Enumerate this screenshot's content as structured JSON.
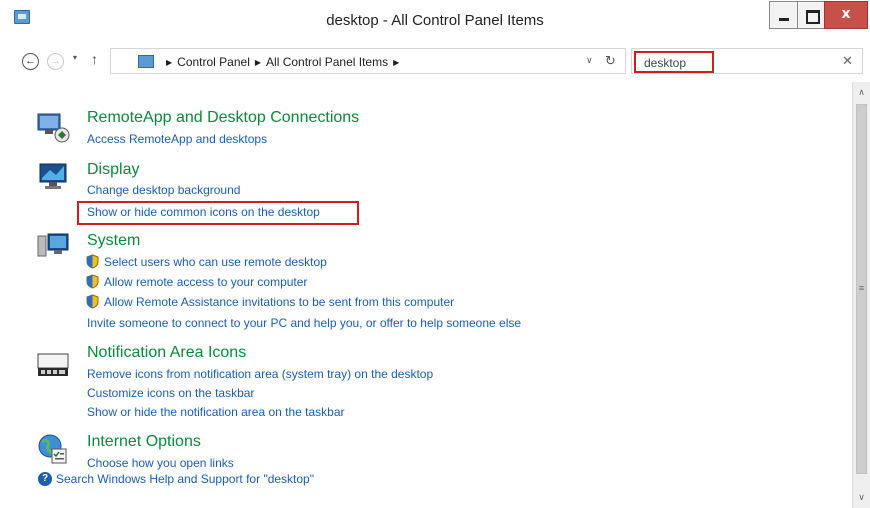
{
  "window": {
    "title": "desktop - All Control Panel Items",
    "minimize_glyph": "",
    "maximize_glyph": "",
    "close_glyph": "x"
  },
  "nav": {
    "back_glyph": "←",
    "forward_glyph": "→",
    "recent_glyph": "▾",
    "up_glyph": "↑",
    "breadcrumbs": [
      "Control Panel",
      "All Control Panel Items"
    ],
    "crumb_separator": "▶",
    "dropdown_glyph": "∨",
    "refresh_glyph": "↻"
  },
  "search": {
    "value": "desktop",
    "clear_glyph": "✕"
  },
  "groups": [
    {
      "title": "RemoteApp and Desktop Connections",
      "icon": "remote-desktop-icon",
      "links": [
        "Access RemoteApp and desktops"
      ]
    },
    {
      "title": "Display",
      "icon": "monitor-icon",
      "links": [
        "Change desktop background",
        "Show or hide common icons on the desktop"
      ]
    },
    {
      "title": "System",
      "icon": "computer-icon",
      "links": [
        "Select users who can use remote desktop",
        "Allow remote access to your computer",
        "Allow Remote Assistance invitations to be sent from this computer",
        "Invite someone to connect to your PC and help you, or offer to help someone else"
      ]
    },
    {
      "title": "Notification Area Icons",
      "icon": "taskbar-icon",
      "links": [
        "Remove icons from notification area (system tray) on the desktop",
        "Customize icons on the taskbar",
        "Show or hide the notification area on the taskbar"
      ]
    },
    {
      "title": "Internet Options",
      "icon": "internet-options-icon",
      "links": [
        "Choose how you open links"
      ]
    }
  ],
  "footer": {
    "help_glyph": "?",
    "link": "Search Windows Help and Support for \"desktop\""
  },
  "scrollbar": {
    "up_glyph": "∧",
    "grip_glyph": "≡",
    "down_glyph": "∨"
  },
  "colors": {
    "group_title": "#0a8a3a",
    "link": "#1b5db0",
    "highlight": "#cc1f1f",
    "close_button": "#c7504a"
  }
}
